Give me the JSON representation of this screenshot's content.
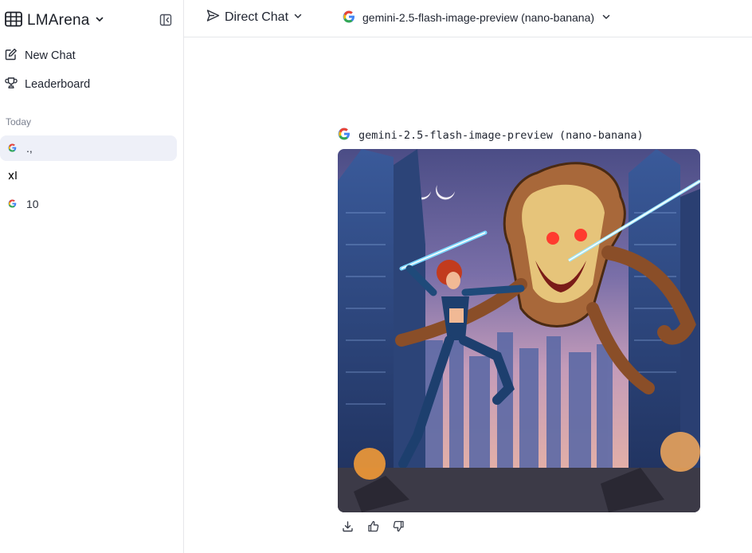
{
  "sidebar": {
    "brand": "LMArena",
    "nav": {
      "new_chat": "New Chat",
      "leaderboard": "Leaderboard"
    },
    "section_label": "Today",
    "history": [
      {
        "title": "., ",
        "icon": "google-g-icon"
      },
      {
        "title": "",
        "icon": "x-ai-icon"
      },
      {
        "title": "10",
        "icon": "google-g-icon"
      }
    ]
  },
  "header": {
    "mode": "Direct Chat",
    "model": "gemini-2.5-flash-image-preview (nano-banana)"
  },
  "message": {
    "model": "gemini-2.5-flash-image-preview (nano-banana)",
    "image_alt": "Comic-style illustration: a red-haired heroine with a glowing blade battles a giant monstrous bread slice among city skyscrapers"
  },
  "colors": {
    "accent_bg": "#eef0f8",
    "border": "#e6e7ea",
    "text": "#1f2430",
    "muted": "#7b8190"
  }
}
